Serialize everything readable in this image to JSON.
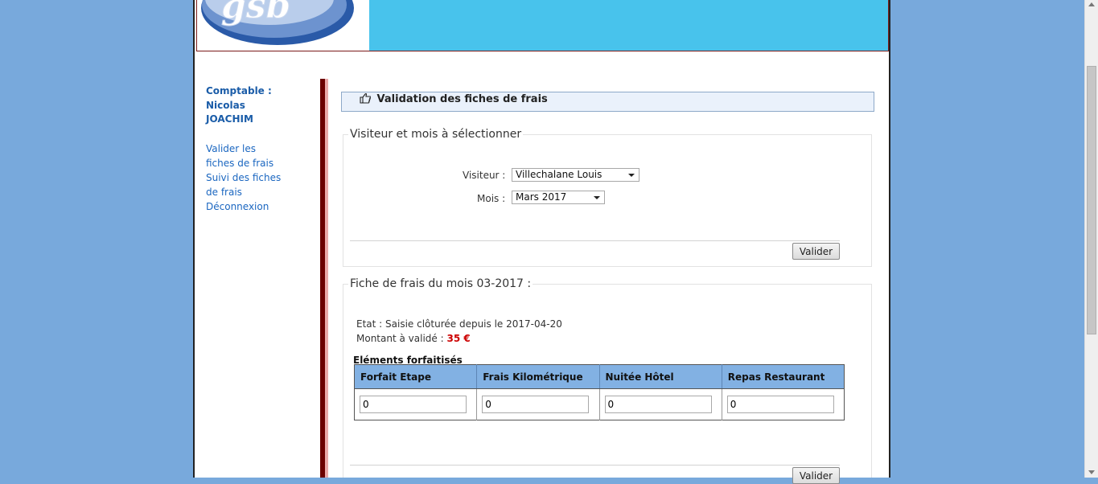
{
  "header": {
    "logo_text": "gsb"
  },
  "sidebar": {
    "role_label": "Comptable :",
    "user_first": "Nicolas",
    "user_last": "JOACHIM",
    "links": [
      "Valider les",
      "fiches de frais",
      "Suivi des fiches",
      "de frais",
      "Déconnexion"
    ]
  },
  "main": {
    "title": "Validation des fiches de frais",
    "selector": {
      "legend": "Visiteur et mois à sélectionner",
      "visitor_label": "Visiteur :",
      "visitor_value": "Villechalane Louis",
      "month_label": "Mois :",
      "month_value": "Mars 2017",
      "submit": "Valider"
    },
    "fiche": {
      "legend": "Fiche de frais du mois 03-2017 :",
      "etat_label": "Etat :",
      "etat_value": "Saisie clôturée depuis le 2017-04-20",
      "montant_label": "Montant à validé :",
      "montant_value": "35 €",
      "section_title": "Eléments forfaitisés",
      "columns": [
        "Forfait Etape",
        "Frais Kilométrique",
        "Nuitée Hôtel",
        "Repas Restaurant"
      ],
      "values": [
        "0",
        "0",
        "0",
        "0"
      ],
      "submit": "Valider"
    }
  },
  "colors": {
    "background": "#78a9dc",
    "banner": "#48c3ec",
    "table_header": "#82b1e3",
    "amount": "#cc0000"
  }
}
